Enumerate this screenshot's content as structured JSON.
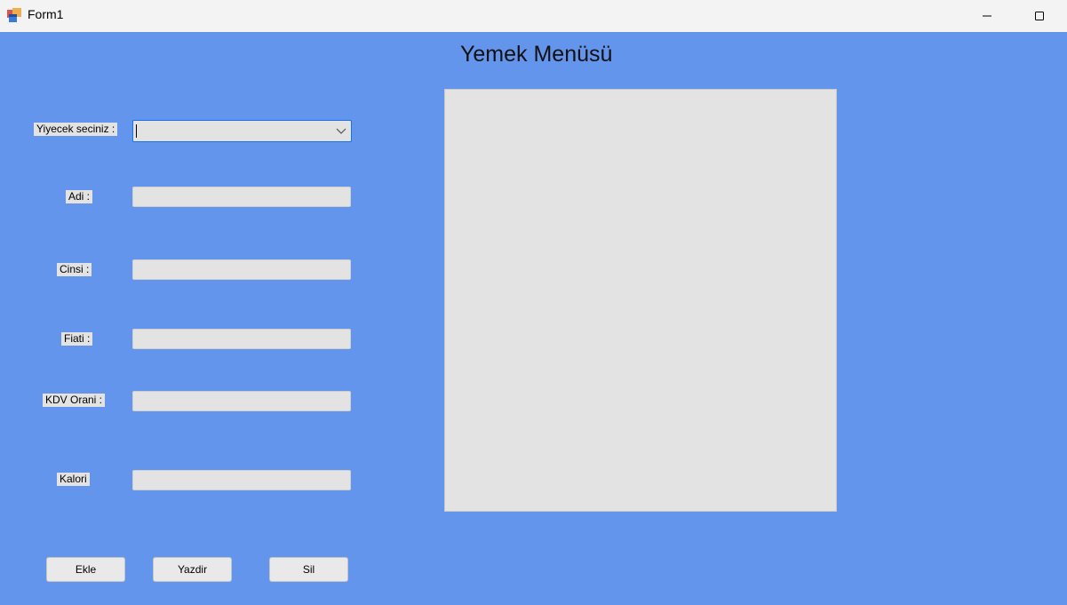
{
  "window": {
    "title": "Form1",
    "icon": "winforms-app-icon",
    "controls": [
      "minimize-icon",
      "maximize-icon"
    ]
  },
  "form": {
    "heading": "Yemek Menüsü",
    "labels": {
      "yiyecek": "Yiyecek seciniz :",
      "adi": "Adi :",
      "cinsi": "Cinsi :",
      "fiati": "Fiati :",
      "kdv": "KDV Orani :",
      "kalori": "Kalori"
    },
    "fields": {
      "yiyecek_value": "",
      "adi_value": "",
      "cinsi_value": "",
      "fiati_value": "",
      "kdv_value": "",
      "kalori_value": ""
    },
    "buttons": {
      "ekle": "Ekle",
      "yazdir": "Yazdir",
      "sil": "Sil"
    }
  },
  "colors": {
    "form_background": "#6495ed",
    "control_background": "#e3e3e3",
    "focus_border": "#1a73e8"
  }
}
